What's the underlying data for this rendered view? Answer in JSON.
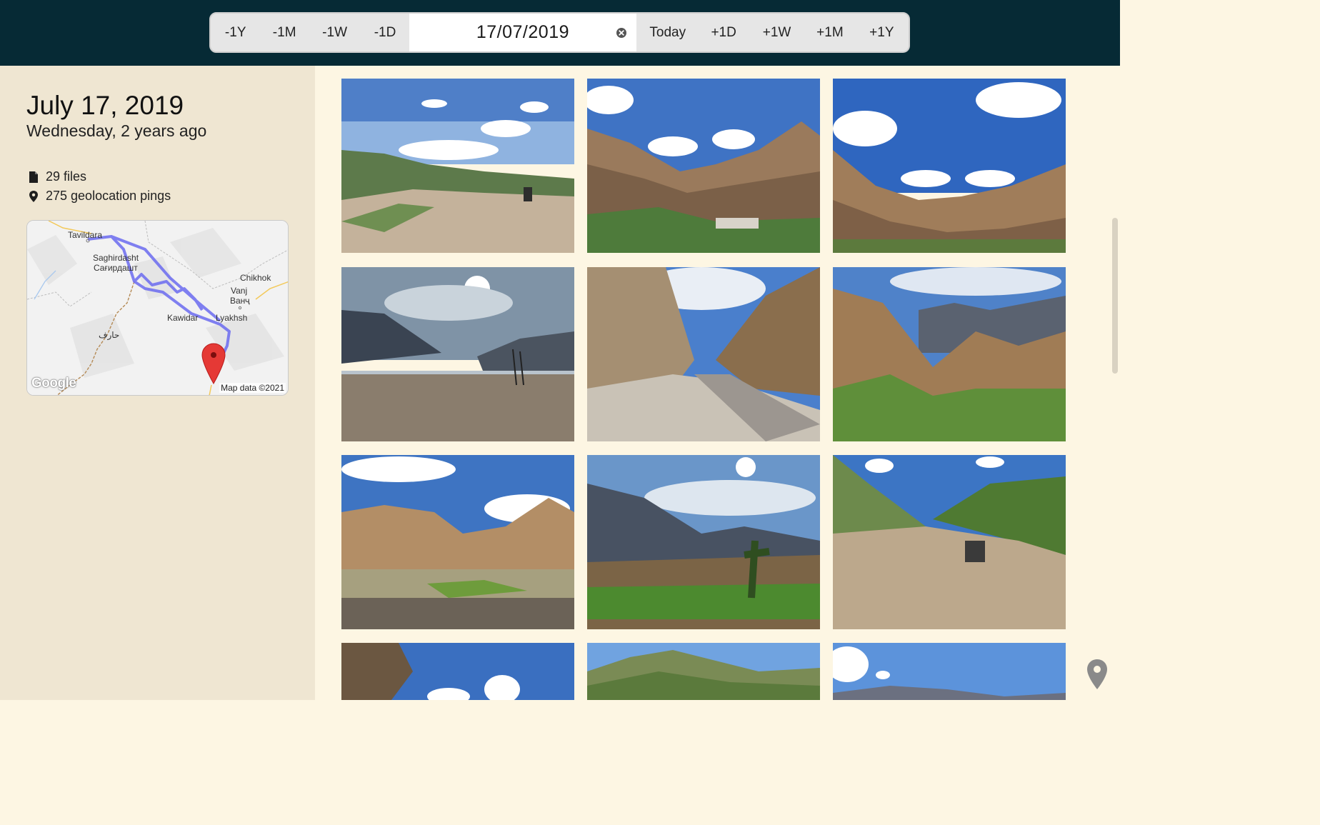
{
  "date_nav": {
    "minus_year": "-1Y",
    "minus_month": "-1M",
    "minus_week": "-1W",
    "minus_day": "-1D",
    "date_value": "17/07/2019",
    "today": "Today",
    "plus_day": "+1D",
    "plus_week": "+1W",
    "plus_month": "+1M",
    "plus_year": "+1Y",
    "clear_icon": "close-circle-icon"
  },
  "sidebar": {
    "title": "July 17, 2019",
    "subtitle": "Wednesday, 2 years ago",
    "files_icon": "file-icon",
    "files": "29 files",
    "pings_icon": "map-pin-icon",
    "pings": "275 geolocation pings"
  },
  "map": {
    "labels": {
      "tavildara": "Tavildara",
      "saghirdasht": "Saghirdasht",
      "saghirdasht_cyr": "Сағирдашт",
      "chikhoko": "Chikhok",
      "vanj": "Vanj",
      "vanj_cyr": "Ванҷ",
      "kawidar": "Kawidar",
      "yakhsh": "Lyakhsh",
      "arabic": "حارف"
    },
    "logo": "Google",
    "copyright": "Map data ©2021",
    "route_color": "#6b6bf0",
    "marker_color": "#e53935"
  },
  "photos": [
    {
      "name": "photo-1",
      "description": "mountain viewpoint with motorbike"
    },
    {
      "name": "photo-2",
      "description": "river valley with village"
    },
    {
      "name": "photo-3",
      "description": "mountain valley with clouds"
    },
    {
      "name": "photo-4",
      "description": "riverbed with sun and power line"
    },
    {
      "name": "photo-5",
      "description": "gravel road in canyon"
    },
    {
      "name": "photo-6",
      "description": "rocky cliffs with green fields"
    },
    {
      "name": "photo-7",
      "description": "wide valley with green fields"
    },
    {
      "name": "photo-8",
      "description": "sunny valley with tree"
    },
    {
      "name": "photo-9",
      "description": "dirt road with motorbike"
    },
    {
      "name": "photo-10",
      "description": "cliff and sky"
    },
    {
      "name": "photo-11",
      "description": "mountain ridge"
    },
    {
      "name": "photo-12",
      "description": "sky with clouds"
    }
  ],
  "floating_button_icon": "map-pin-icon"
}
